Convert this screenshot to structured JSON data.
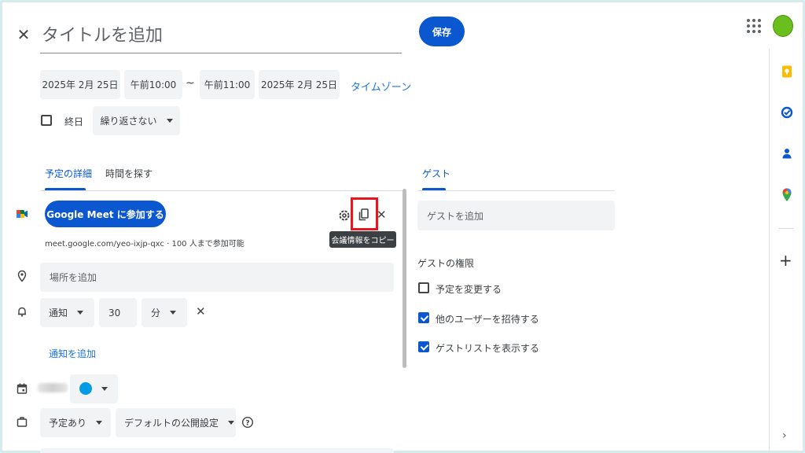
{
  "header": {
    "title_placeholder": "タイトルを追加",
    "save_label": "保存"
  },
  "datetime": {
    "start_date": "2025年 2月 25日",
    "start_time": "午前10:00",
    "separator": "~",
    "end_time": "午前11:00",
    "end_date": "2025年 2月 25日",
    "timezone_label": "タイムゾーン"
  },
  "options": {
    "all_day_label": "終日",
    "all_day_checked": false,
    "repeat_value": "繰り返さない"
  },
  "tabs": {
    "details": "予定の詳細",
    "find_time": "時間を探す",
    "guests": "ゲスト"
  },
  "meet": {
    "button_label": "Google Meet に参加する",
    "info": "meet.google.com/yeo-ixjp-qxc · 100 人まで参加可能",
    "tooltip": "会議情報をコピー"
  },
  "location": {
    "placeholder": "場所を追加"
  },
  "notification": {
    "type": "通知",
    "amount": "30",
    "unit": "分",
    "add_label": "通知を追加"
  },
  "status": {
    "availability": "予定あり",
    "visibility": "デフォルトの公開設定"
  },
  "guests": {
    "add_placeholder": "ゲストを追加",
    "permissions_title": "ゲストの権限",
    "permissions": [
      {
        "label": "予定を変更する",
        "checked": false
      },
      {
        "label": "他のユーザーを招待する",
        "checked": true
      },
      {
        "label": "ゲストリストを表示する",
        "checked": true
      }
    ]
  },
  "colors": {
    "accent": "#0b57d0",
    "event_color": "#039be5",
    "highlight": "#e8141e",
    "avatar": "#6abf1f"
  },
  "icons": {
    "close": "close-icon",
    "apps": "apps-grid-icon",
    "meet": "google-meet-icon",
    "settings": "gear-icon",
    "copy": "copy-icon",
    "remove": "close-icon",
    "location": "location-pin-icon",
    "bell": "bell-icon",
    "calendar": "calendar-icon",
    "briefcase": "briefcase-icon",
    "help": "help-circle-icon",
    "keep": "keep-icon",
    "tasks": "tasks-icon",
    "contacts": "contacts-icon",
    "maps": "maps-icon",
    "add": "plus-icon",
    "expand": "chevron-right-icon"
  }
}
